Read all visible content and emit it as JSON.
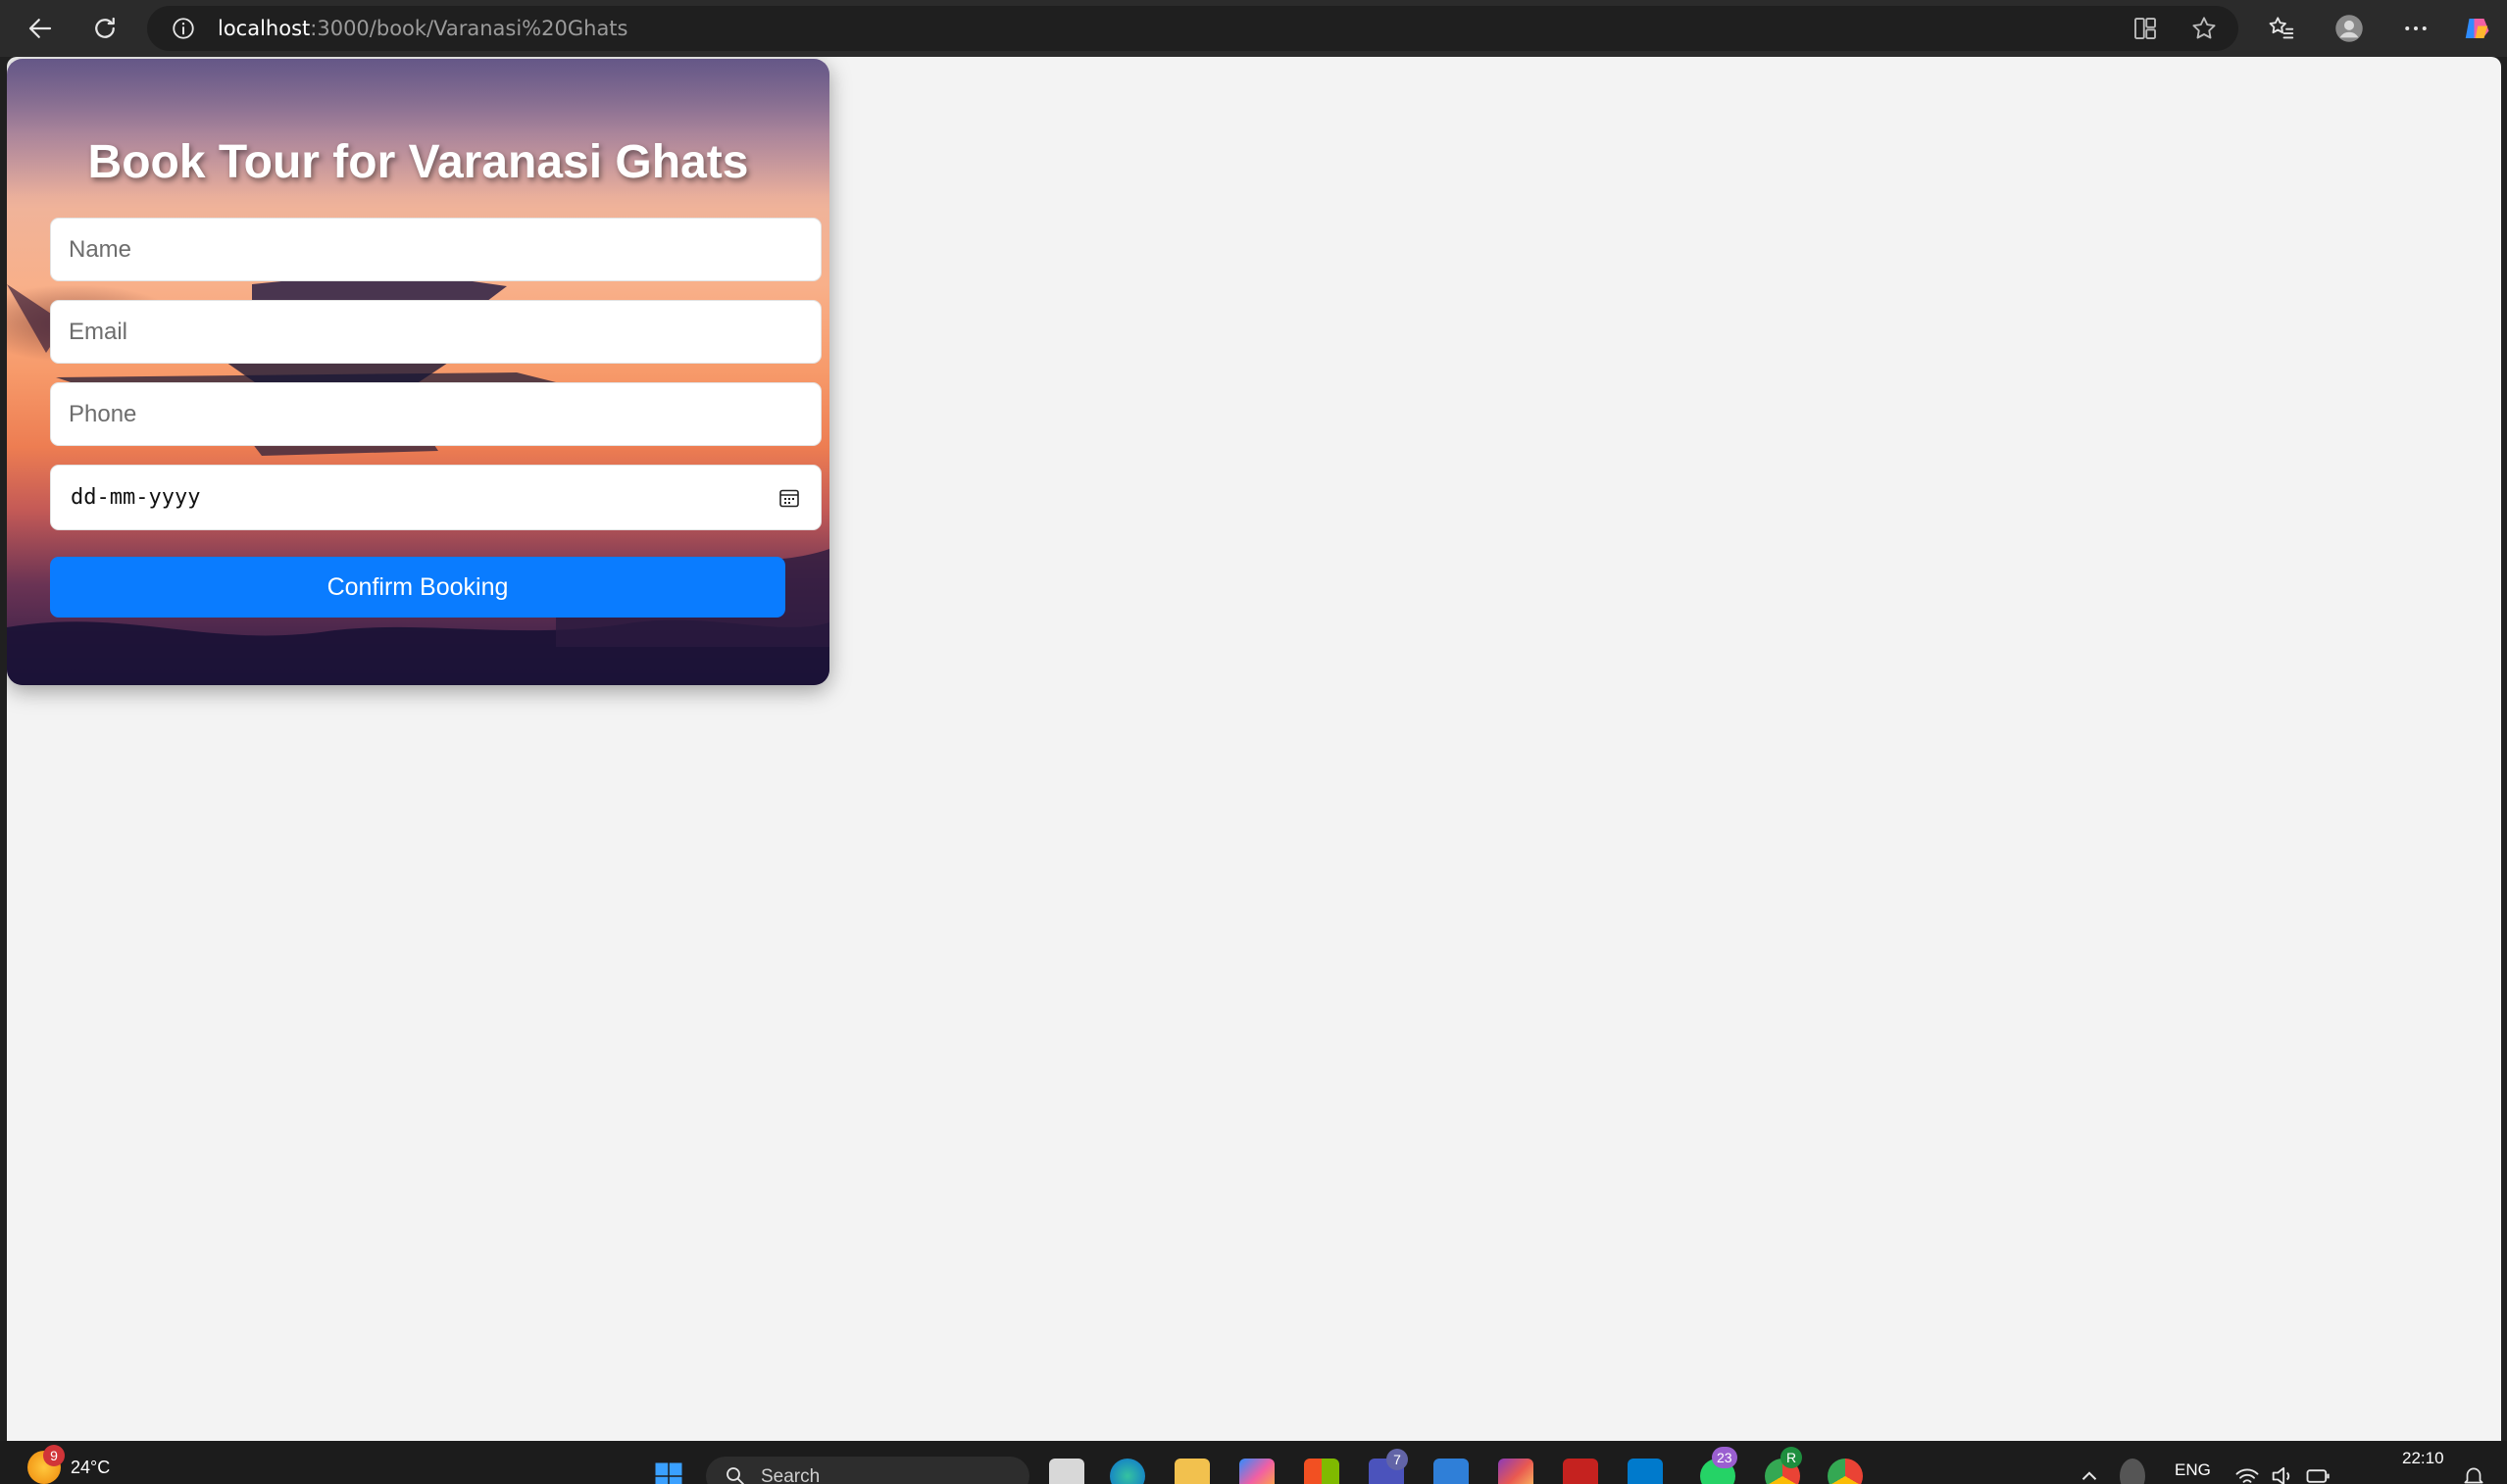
{
  "browser": {
    "url_host": "localhost",
    "url_rest": ":3000/book/Varanasi%20Ghats",
    "back_icon": "back-arrow-icon",
    "refresh_icon": "refresh-icon",
    "info_icon": "info-icon"
  },
  "form": {
    "title": "Book Tour for Varanasi Ghats",
    "name_placeholder": "Name",
    "email_placeholder": "Email",
    "phone_placeholder": "Phone",
    "date_value": "dd-mm-yyyy",
    "submit_label": "Confirm Booking",
    "accent_color": "#0a7cff"
  },
  "taskbar": {
    "weather_temp": "24°C",
    "weather_badge": "9",
    "search_label": "Search",
    "teams_badge": "7",
    "whatsapp_badge": "23",
    "chrome_badge": "R",
    "language": "ENG",
    "time": "22:10"
  }
}
